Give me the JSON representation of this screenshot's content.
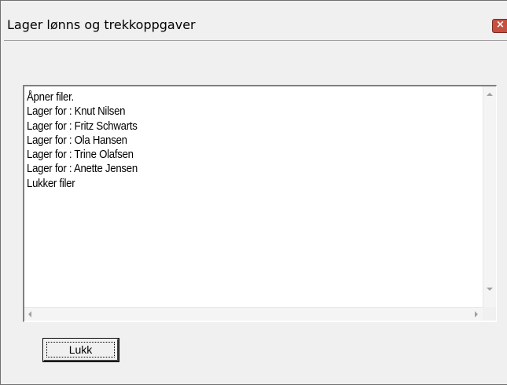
{
  "window": {
    "title": "Lager lønns og trekkoppgaver",
    "close_label": "×"
  },
  "log": {
    "lines": [
      "Åpner filer.",
      "Lager for : Knut Nilsen",
      "Lager for : Fritz Schwarts",
      "Lager for : Ola Hansen",
      "Lager for : Trine Olafsen",
      "Lager for : Anette Jensen",
      "Lukker filer"
    ]
  },
  "buttons": {
    "close_label": "Lukk"
  },
  "icons": {
    "close": "close-icon",
    "scroll_up": "arrow-up-icon",
    "scroll_down": "arrow-down-icon",
    "scroll_left": "arrow-left-icon",
    "scroll_right": "arrow-right-icon"
  }
}
